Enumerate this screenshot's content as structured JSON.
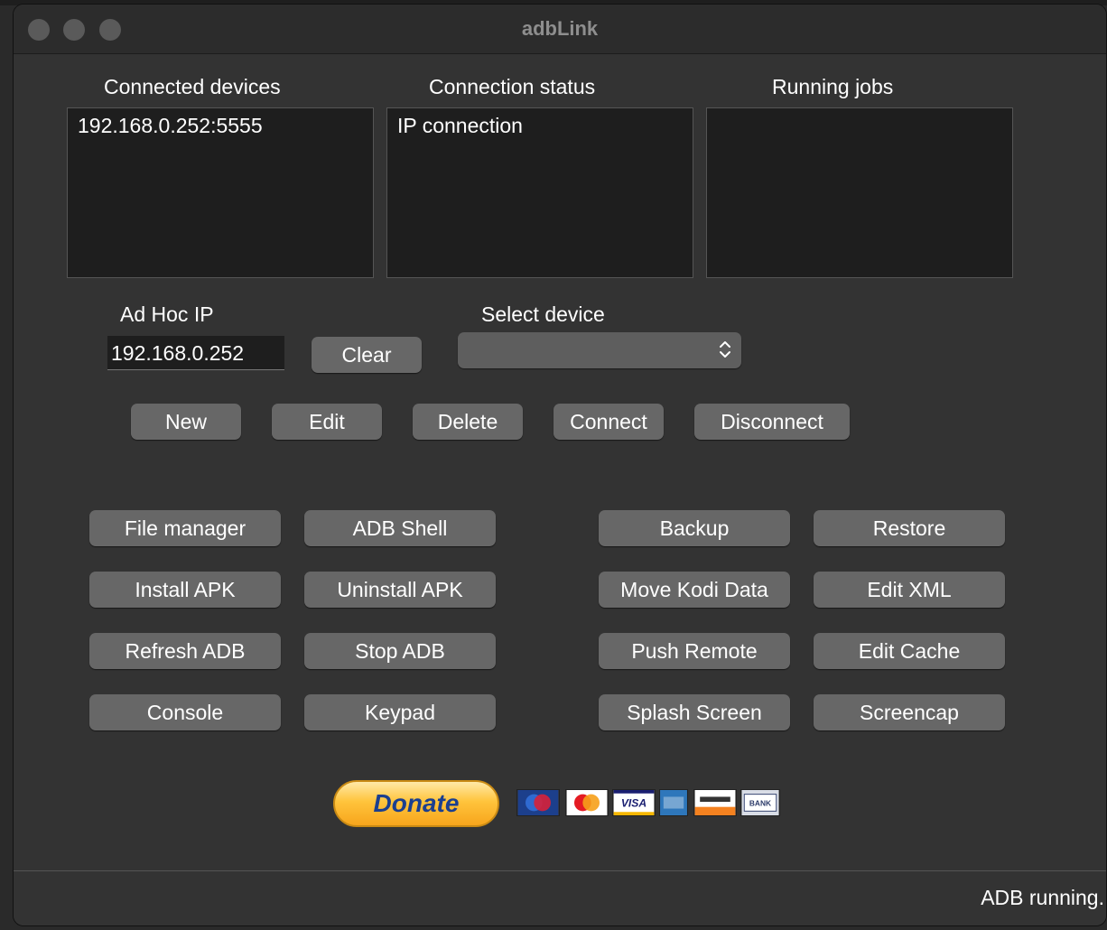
{
  "window": {
    "title": "adbLink"
  },
  "panels": {
    "connected_devices": {
      "label": "Connected devices",
      "items": [
        "192.168.0.252:5555"
      ]
    },
    "connection_status": {
      "label": "Connection status",
      "items": [
        "IP connection"
      ]
    },
    "running_jobs": {
      "label": "Running jobs",
      "items": []
    }
  },
  "adhoc": {
    "label": "Ad Hoc IP",
    "value": "192.168.0.252",
    "clear_label": "Clear"
  },
  "device_select": {
    "label": "Select device",
    "value": ""
  },
  "device_buttons": {
    "new": "New",
    "edit": "Edit",
    "delete": "Delete",
    "connect": "Connect",
    "disconnect": "Disconnect"
  },
  "actions": {
    "file_manager": "File manager",
    "adb_shell": "ADB Shell",
    "backup": "Backup",
    "restore": "Restore",
    "install_apk": "Install APK",
    "uninstall_apk": "Uninstall APK",
    "move_kodi_data": "Move Kodi Data",
    "edit_xml": "Edit XML",
    "refresh_adb": "Refresh ADB",
    "stop_adb": "Stop ADB",
    "push_remote": "Push Remote",
    "edit_cache": "Edit Cache",
    "console": "Console",
    "keypad": "Keypad",
    "splash_screen": "Splash Screen",
    "screencap": "Screencap"
  },
  "donate": {
    "label": "Donate",
    "cards": [
      "Maestro",
      "MasterCard",
      "VISA",
      "AMERICAN EXPRESS",
      "DISCOVER",
      "BANK"
    ]
  },
  "status": {
    "text": "ADB running."
  },
  "colors": {
    "window_bg": "#333333",
    "panel_bg": "#1e1e1e",
    "button_bg": "#676767",
    "donate_orange": "#ffc43c",
    "donate_text": "#1b3f8f"
  }
}
